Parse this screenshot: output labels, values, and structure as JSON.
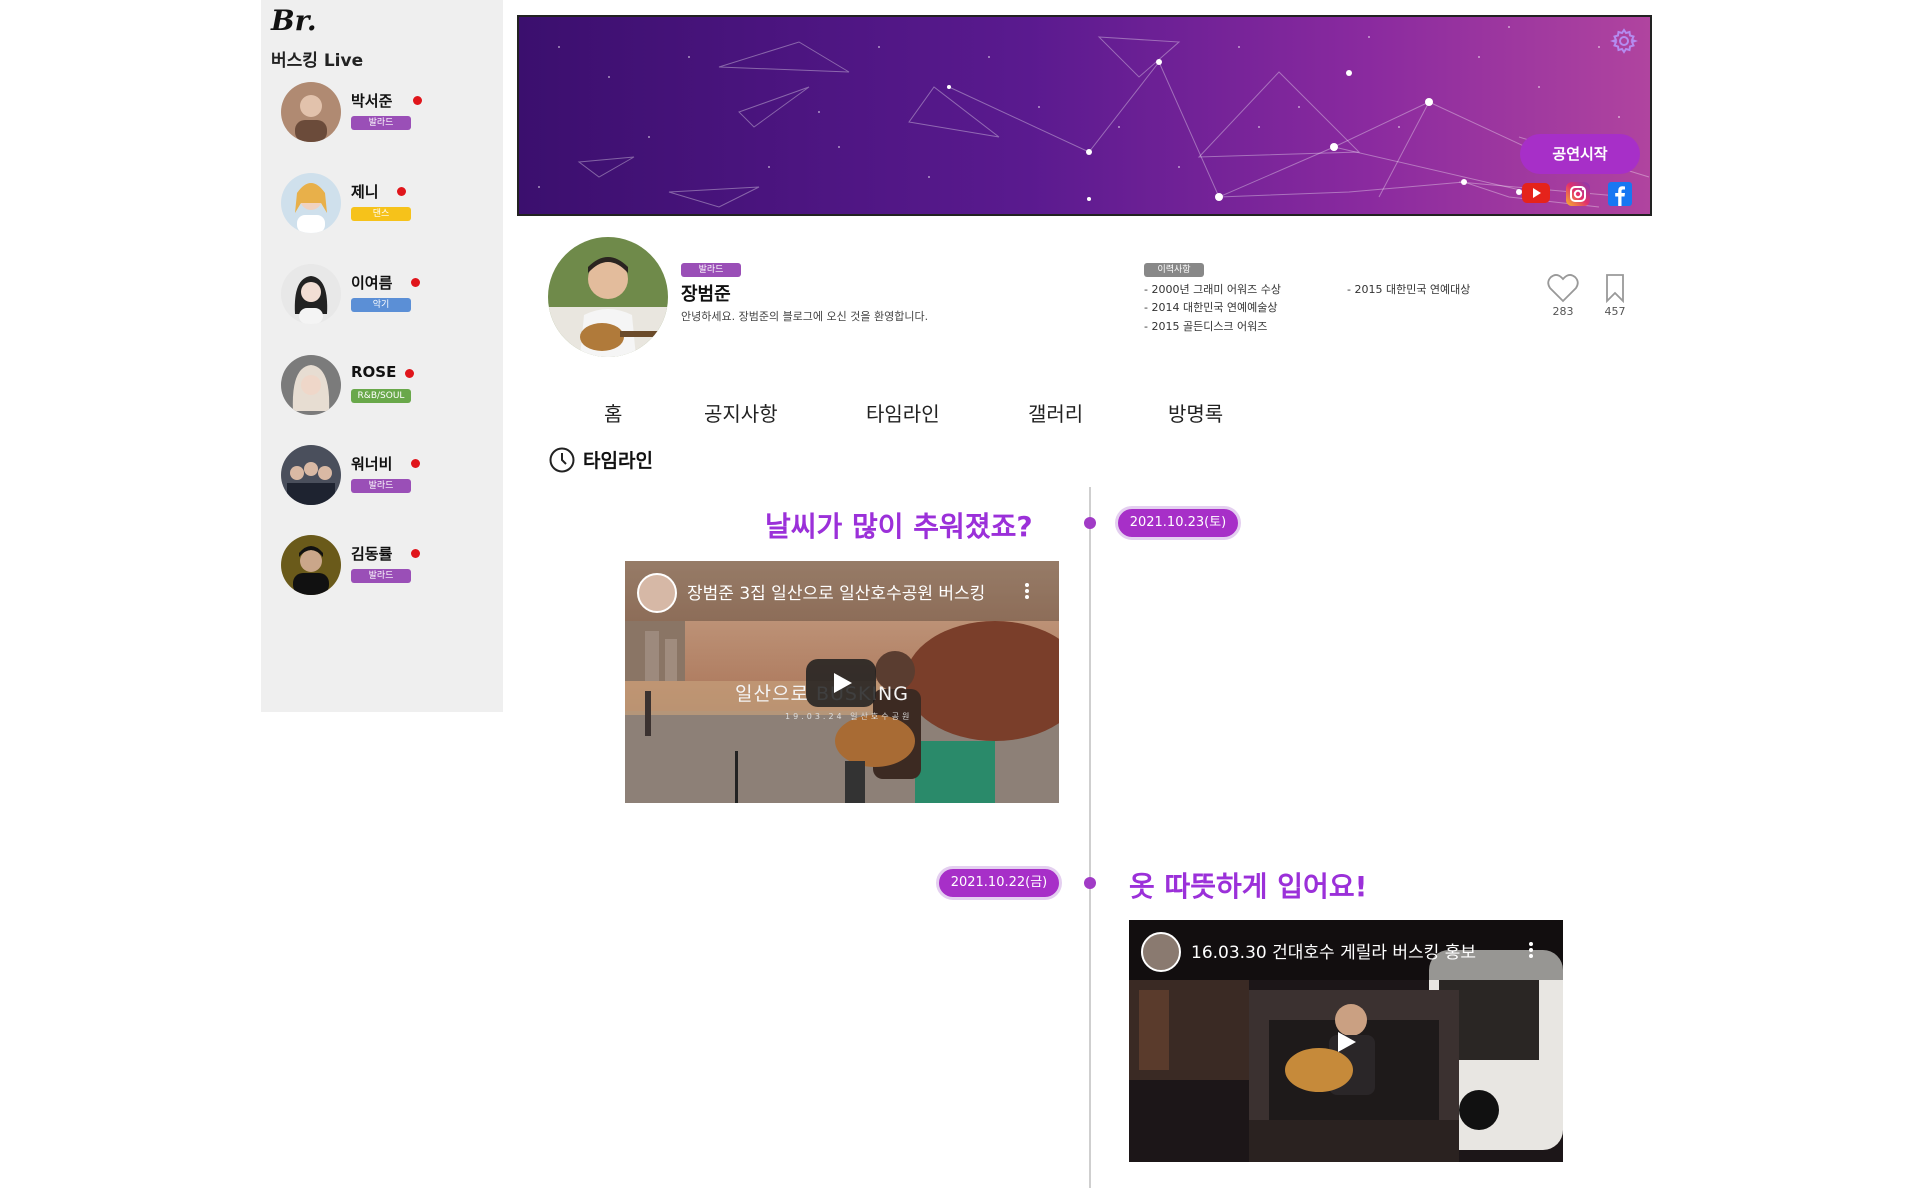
{
  "sidebar": {
    "logo": "Br.",
    "subtitle": "버스킹 Live",
    "items": [
      {
        "name": "박서준",
        "tag": "발라드",
        "tag_color": "#9a4fb7"
      },
      {
        "name": "제니",
        "tag": "댄스",
        "tag_color": "#f6c21a"
      },
      {
        "name": "이여름",
        "tag": "악기",
        "tag_color": "#5b8fd6"
      },
      {
        "name": "ROSE",
        "tag": "R&B/SOUL",
        "tag_color": "#69a84a"
      },
      {
        "name": "워너비",
        "tag": "발라드",
        "tag_color": "#9a4fb7"
      },
      {
        "name": "김동률",
        "tag": "발라드",
        "tag_color": "#9a4fb7"
      }
    ],
    "live_dot_color": "#e0151b"
  },
  "banner": {
    "start_button": "공연시작",
    "settings_icon": "gear-icon",
    "socials": [
      "youtube-icon",
      "instagram-icon",
      "facebook-icon"
    ]
  },
  "profile": {
    "genre": "발라드",
    "name": "장범준",
    "intro": "안녕하세요. 장범준의 블로그에 오신 것을 환영합니다.",
    "career_label": "이력사항",
    "career": [
      "- 2000년 그래미 어워즈 수상",
      "- 2014 대한민국 연예예술상",
      "- 2015 골든디스크 어워즈",
      "- 2015 대한민국 연예대상"
    ],
    "likes": "283",
    "bookmarks": "457"
  },
  "tabs": [
    "홈",
    "공지사항",
    "타임라인",
    "갤러리",
    "방명록"
  ],
  "timeline": {
    "title": "타임라인",
    "posts": [
      {
        "date": "2021.10.23(토)",
        "title": "날씨가 많이 추워졌죠?",
        "video_title": "장범준 3집 일산으로 일산호수공원 버스킹",
        "overlay_text": "일산으로 BUSKING",
        "overlay_sub": "19.03.24 일산호수공원"
      },
      {
        "date": "2021.10.22(금)",
        "title": "옷 따뜻하게 입어요!",
        "video_title": "16.03.30 건대호수 게릴라 버스킹 홍보"
      }
    ]
  },
  "colors": {
    "accent": "#a72fc8",
    "title_purple": "#9b30d9",
    "sidebar_bg": "#efefef"
  }
}
